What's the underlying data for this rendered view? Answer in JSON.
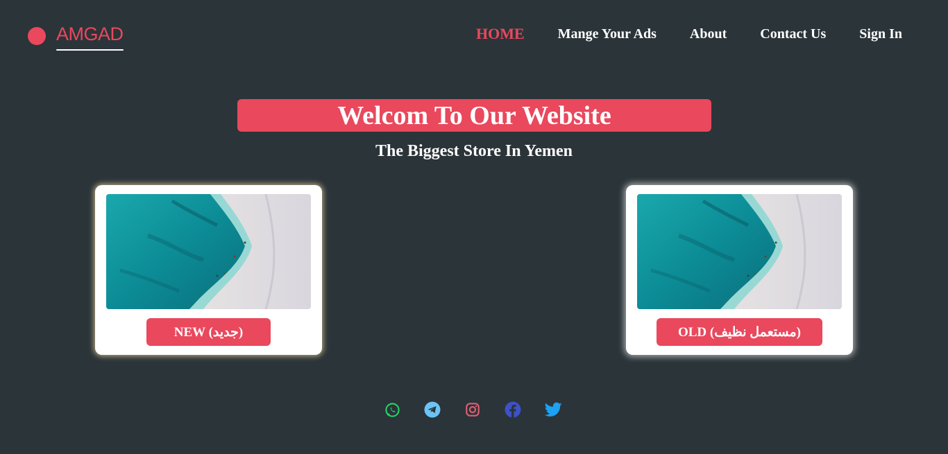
{
  "brand": {
    "name": "AMGAD"
  },
  "nav": {
    "items": [
      {
        "label": "HOME",
        "active": true
      },
      {
        "label": "Mange Your Ads",
        "active": false
      },
      {
        "label": "About",
        "active": false
      },
      {
        "label": "Contact Us",
        "active": false
      },
      {
        "label": "Sign In",
        "active": false
      }
    ]
  },
  "hero": {
    "title": "Welcom To Our Website",
    "subtitle": "The Biggest Store In Yemen"
  },
  "cards": [
    {
      "image": "beach-aerial-image",
      "button_label": "NEW (جديد)"
    },
    {
      "image": "beach-aerial-image",
      "button_label": "OLD (مستعمل نظيف)"
    }
  ],
  "social": {
    "icons": [
      "whatsapp-icon",
      "telegram-icon",
      "instagram-icon",
      "facebook-icon",
      "twitter-icon"
    ]
  },
  "colors": {
    "background": "#2b3439",
    "accent": "#e9485d",
    "text": "#ffffff",
    "whatsapp": "#25d366",
    "telegram": "#6cc3f5",
    "instagram": "#e35d73",
    "facebook": "#3f51c7",
    "twitter": "#1da1f2"
  }
}
